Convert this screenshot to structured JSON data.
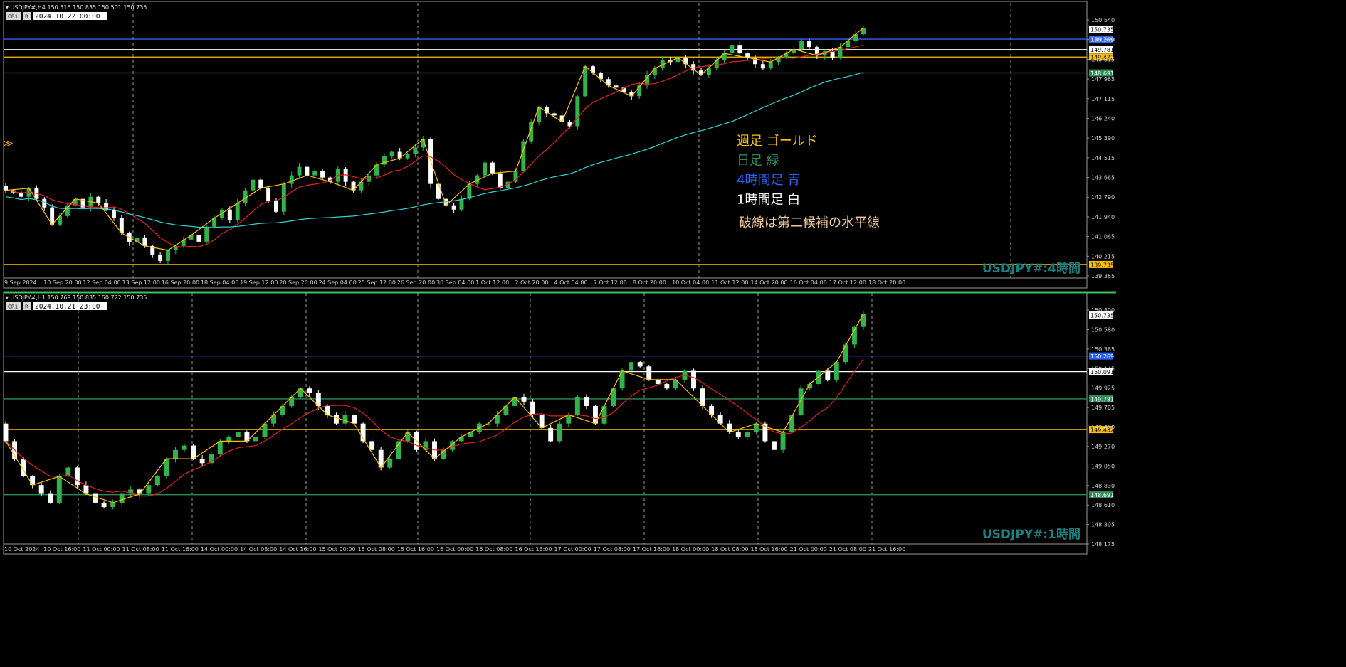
{
  "colors": {
    "background": "#000000",
    "grid": "#c8c8c8",
    "bull": "#2fb34a",
    "bear": "#ffffff",
    "sma_red": "#e02020",
    "sma_cyan": "#2fd3d3",
    "zigzag": "#ffc000",
    "zigzag_alt": "#2fff8f",
    "level_weekly": "#ffc000",
    "level_daily": "#2e8b57",
    "level_h4": "#2b63ff",
    "level_h1": "#ffffff",
    "watermark": "#1a7f80",
    "axis_text": "#d0d0d0"
  },
  "chart_data": [
    {
      "id": "h4",
      "type": "candlestick",
      "header": "USDJPY#,H4  150.516 150.835 150.501 150.735",
      "tag_cr1": "CR1",
      "tag_r": "R",
      "datetime_box": "2024.10.22 00:00",
      "watermark": "USDJPY#:4時間",
      "ylim": [
        139.2,
        151.9
      ],
      "y_ticks": [
        "150.540",
        "149.690",
        "148.815",
        "147.965",
        "147.115",
        "146.240",
        "145.390",
        "144.515",
        "143.665",
        "142.790",
        "141.940",
        "141.065",
        "140.215",
        "139.365"
      ],
      "x_labels": [
        "9 Sep 2024",
        "10 Sep 20:00",
        "12 Sep 04:00",
        "13 Sep 12:00",
        "16 Sep 20:00",
        "18 Sep 04:00",
        "19 Sep 12:00",
        "20 Sep 20:00",
        "24 Sep 04:00",
        "25 Sep 12:00",
        "26 Sep 20:00",
        "30 Sep 04:00",
        "1 Oct 12:00",
        "2 Oct 20:00",
        "4 Oct 04:00",
        "7 Oct 12:00",
        "8 Oct 20:00",
        "10 Oct 04:00",
        "11 Oct 12:00",
        "14 Oct 20:00",
        "16 Oct 04:00",
        "17 Oct 12:00",
        "18 Oct 20:00"
      ],
      "levels": [
        {
          "value": 150.269,
          "label": "150.269",
          "kind": "h4"
        },
        {
          "value": 149.781,
          "label": "149.781",
          "kind": "h1"
        },
        {
          "value": 149.432,
          "label": "149.432",
          "kind": "weekly"
        },
        {
          "value": 148.691,
          "label": "148.691",
          "kind": "daily"
        },
        {
          "value": 139.735,
          "label": "139.735",
          "kind": "weekly"
        }
      ],
      "last_price": {
        "value": 150.735,
        "label": "150.735"
      },
      "legend": [
        {
          "text": "週足  ゴールド",
          "kind": "weekly"
        },
        {
          "text": "日足  緑",
          "kind": "daily"
        },
        {
          "text": "4時間足  青",
          "kind": "h4"
        },
        {
          "text": "1時間足  白",
          "kind": "h1"
        },
        {
          "text": "破線は第二候補の水平線",
          "kind": "note"
        }
      ],
      "closes": [
        143.2,
        143.1,
        142.9,
        143.3,
        142.8,
        142.4,
        141.6,
        142.0,
        142.5,
        142.8,
        142.4,
        142.9,
        142.6,
        142.3,
        141.9,
        141.2,
        140.8,
        141.0,
        140.6,
        140.2,
        139.9,
        140.4,
        140.6,
        140.9,
        141.1,
        140.8,
        141.5,
        141.9,
        142.3,
        141.8,
        142.6,
        143.2,
        143.7,
        143.3,
        142.7,
        142.2,
        143.5,
        143.9,
        144.3,
        143.9,
        144.1,
        143.8,
        143.6,
        144.2,
        143.6,
        143.2,
        143.6,
        143.9,
        144.4,
        144.8,
        145.0,
        144.7,
        144.9,
        145.2,
        145.6,
        143.5,
        142.8,
        142.5,
        142.3,
        142.8,
        143.5,
        143.9,
        144.5,
        144.0,
        143.3,
        143.6,
        144.1,
        145.5,
        146.4,
        147.1,
        146.8,
        146.7,
        146.4,
        146.2,
        147.6,
        149.0,
        148.7,
        148.4,
        148.1,
        148.0,
        147.8,
        147.6,
        148.1,
        148.6,
        148.9,
        149.3,
        149.2,
        149.4,
        149.1,
        148.8,
        148.6,
        148.9,
        149.3,
        149.6,
        150.0,
        149.6,
        149.4,
        149.1,
        148.9,
        149.2,
        149.4,
        149.6,
        149.8,
        150.2,
        149.9,
        149.5,
        149.7,
        149.4,
        149.9,
        150.2,
        150.5,
        150.8
      ]
    },
    {
      "id": "h1",
      "type": "candlestick",
      "header": "USDJPY#,H1  150.769 150.835 150.722 150.735",
      "tag_cr1": "CR1",
      "tag_r": "R",
      "datetime_box": "2024.10.21 23:00",
      "watermark": "USDJPY#:1時間",
      "ylim": [
        148.13,
        150.97
      ],
      "y_ticks": [
        "150.800",
        "150.580",
        "150.365",
        "150.145",
        "149.925",
        "149.705",
        "149.490",
        "149.270",
        "149.050",
        "148.830",
        "148.610",
        "148.395",
        "148.175"
      ],
      "x_labels": [
        "10 Oct 2024",
        "10 Oct 16:00",
        "11 Oct 00:00",
        "11 Oct 08:00",
        "11 Oct 16:00",
        "14 Oct 00:00",
        "14 Oct 08:00",
        "14 Oct 16:00",
        "15 Oct 00:00",
        "15 Oct 08:00",
        "15 Oct 16:00",
        "16 Oct 00:00",
        "16 Oct 08:00",
        "16 Oct 16:00",
        "17 Oct 00:00",
        "17 Oct 08:00",
        "17 Oct 16:00",
        "18 Oct 00:00",
        "18 Oct 08:00",
        "18 Oct 16:00",
        "21 Oct 00:00",
        "21 Oct 08:00",
        "21 Oct 16:00"
      ],
      "levels": [
        {
          "value": 150.269,
          "label": "150.269",
          "kind": "h4"
        },
        {
          "value": 150.091,
          "label": "150.091",
          "kind": "h1"
        },
        {
          "value": 149.781,
          "label": "149.781",
          "kind": "daily"
        },
        {
          "value": 149.432,
          "label": "149.432",
          "kind": "weekly"
        },
        {
          "value": 148.691,
          "label": "148.691",
          "kind": "daily"
        }
      ],
      "last_price": {
        "value": 150.735,
        "label": "150.735"
      },
      "closes": [
        149.3,
        149.1,
        148.9,
        148.8,
        148.7,
        148.6,
        148.9,
        149.0,
        148.8,
        148.7,
        148.6,
        148.55,
        148.6,
        148.7,
        148.75,
        148.7,
        148.8,
        148.9,
        149.1,
        149.2,
        149.25,
        149.1,
        149.05,
        149.15,
        149.3,
        149.35,
        149.4,
        149.3,
        149.35,
        149.5,
        149.6,
        149.7,
        149.8,
        149.9,
        149.85,
        149.7,
        149.6,
        149.5,
        149.6,
        149.5,
        149.3,
        149.2,
        149.0,
        149.1,
        149.3,
        149.4,
        149.2,
        149.3,
        149.1,
        149.2,
        149.3,
        149.35,
        149.4,
        149.5,
        149.5,
        149.6,
        149.7,
        149.8,
        149.75,
        149.6,
        149.45,
        149.3,
        149.5,
        149.6,
        149.8,
        149.7,
        149.5,
        149.7,
        149.9,
        150.1,
        150.2,
        150.15,
        150.0,
        149.95,
        149.9,
        150.0,
        150.1,
        149.9,
        149.7,
        149.6,
        149.5,
        149.4,
        149.35,
        149.4,
        149.5,
        149.3,
        149.2,
        149.4,
        149.6,
        149.9,
        149.95,
        150.1,
        150.0,
        150.2,
        150.4,
        150.6,
        150.75
      ]
    }
  ]
}
